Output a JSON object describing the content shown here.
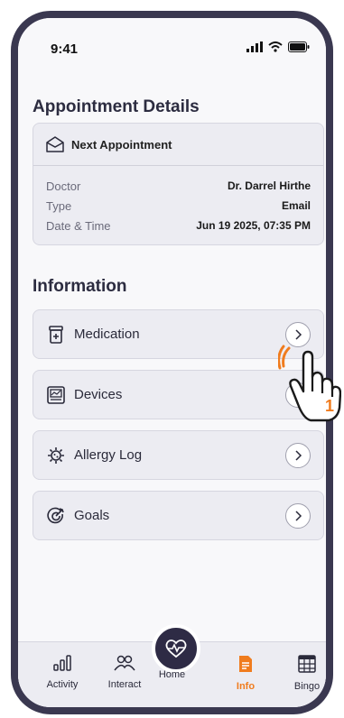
{
  "status_bar": {
    "time": "9:41"
  },
  "appointment": {
    "section_title": "Appointment Details",
    "card_title": "Next Appointment",
    "rows": [
      {
        "key": "Doctor",
        "value": "Dr. Darrel Hirthe"
      },
      {
        "key": "Type",
        "value": "Email"
      },
      {
        "key": "Date & Time",
        "value": "Jun 19 2025, 07:35 PM"
      }
    ]
  },
  "information": {
    "section_title": "Information",
    "items": [
      {
        "label": "Medication",
        "icon": "medication-icon"
      },
      {
        "label": "Devices",
        "icon": "devices-icon"
      },
      {
        "label": "Allergy Log",
        "icon": "allergy-icon"
      },
      {
        "label": "Goals",
        "icon": "goals-icon"
      }
    ]
  },
  "tab_bar": {
    "tabs": [
      {
        "label": "Activity",
        "icon": "activity-icon"
      },
      {
        "label": "Interact",
        "icon": "interact-icon"
      },
      {
        "label": "Home",
        "icon": "heart-pulse-icon"
      },
      {
        "label": "Info",
        "icon": "info-document-icon",
        "active": true
      },
      {
        "label": "Bingo",
        "icon": "bingo-icon"
      }
    ]
  },
  "annotation": {
    "step_number": "1"
  },
  "colors": {
    "accent": "#f07c1e",
    "frame": "#3a3850",
    "card_bg": "#ececf2",
    "fab": "#2e2b45"
  }
}
